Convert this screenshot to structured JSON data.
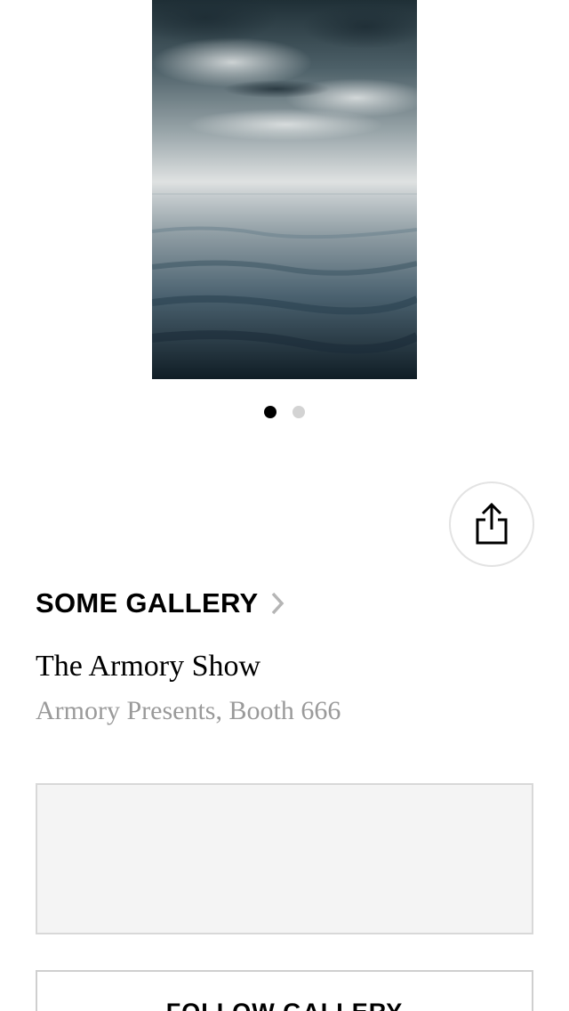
{
  "artwork": {
    "icon": "painting-seascape"
  },
  "carousel": {
    "total_pages": 2,
    "active_page": 1
  },
  "share": {
    "icon": "share-icon"
  },
  "gallery": {
    "name": "SOME GALLERY",
    "chevron_icon": "chevron-right-icon"
  },
  "fair": {
    "name": "The Armory Show",
    "location": "Armory Presents, Booth 666"
  },
  "follow": {
    "label": "FOLLOW GALLERY"
  },
  "colors": {
    "accent": "#000000",
    "muted_text": "#9a9a9a",
    "placeholder_bg": "#f4f4f4"
  }
}
